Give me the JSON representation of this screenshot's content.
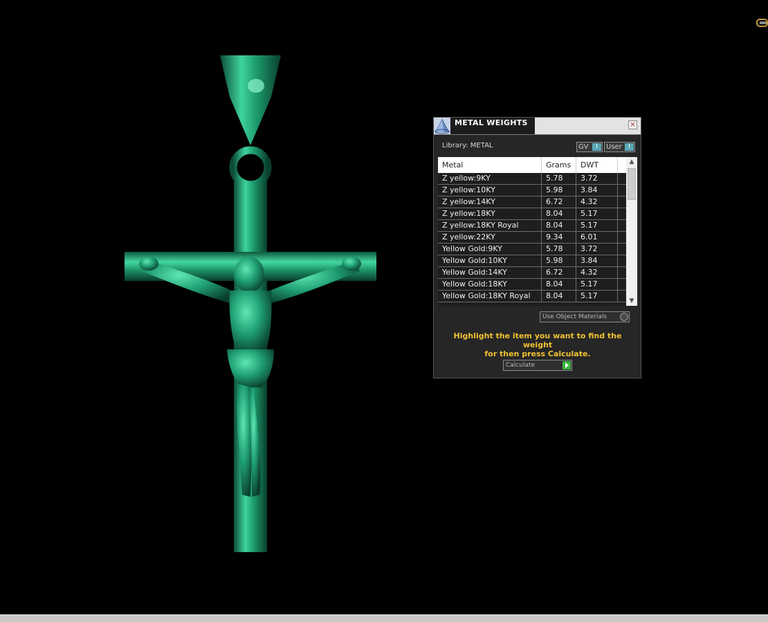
{
  "panel": {
    "title": "METAL WEIGHTS",
    "close_label": "×",
    "library_label": "Library: METAL",
    "toggles": {
      "gv_label": "GV",
      "user_label": "User",
      "toggle_mark": "I"
    },
    "table": {
      "headers": {
        "metal": "Metal",
        "grams": "Grams",
        "dwt": "DWT"
      },
      "rows": [
        {
          "metal": "Z yellow:9KY",
          "grams": "5.78",
          "dwt": "3.72"
        },
        {
          "metal": "Z yellow:10KY",
          "grams": "5.98",
          "dwt": "3.84"
        },
        {
          "metal": "Z yellow:14KY",
          "grams": "6.72",
          "dwt": "4.32"
        },
        {
          "metal": "Z yellow:18KY",
          "grams": "8.04",
          "dwt": "5.17"
        },
        {
          "metal": "Z yellow:18KY Royal",
          "grams": "8.04",
          "dwt": "5.17"
        },
        {
          "metal": "Z yellow:22KY",
          "grams": "9.34",
          "dwt": "6.01"
        },
        {
          "metal": "Yellow Gold:9KY",
          "grams": "5.78",
          "dwt": "3.72"
        },
        {
          "metal": "Yellow Gold:10KY",
          "grams": "5.98",
          "dwt": "3.84"
        },
        {
          "metal": "Yellow Gold:14KY",
          "grams": "6.72",
          "dwt": "4.32"
        },
        {
          "metal": "Yellow Gold:18KY",
          "grams": "8.04",
          "dwt": "5.17"
        },
        {
          "metal": "Yellow Gold:18KY Royal",
          "grams": "8.04",
          "dwt": "5.17"
        }
      ]
    },
    "use_object_materials_label": "Use Object Materials",
    "hint_line1": "Highlight the item you want to find the weight",
    "hint_line2": "for then press Calculate.",
    "calculate_label": "Calculate"
  },
  "colors": {
    "model": "#1f9e72",
    "hint": "#f1c232",
    "toggle_on": "#5aa7b5",
    "go_button": "#3bb33b"
  },
  "icons": {
    "app": "pyramid-app-icon",
    "close": "close-icon",
    "scroll_up": "chevron-up-icon",
    "scroll_down": "chevron-down-icon",
    "calculate": "play-icon"
  }
}
